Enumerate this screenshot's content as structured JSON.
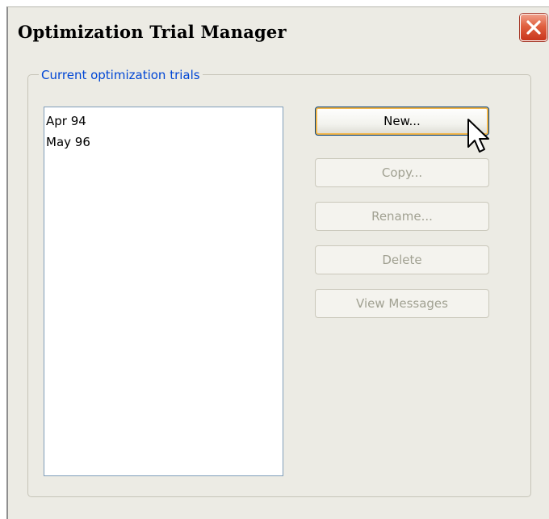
{
  "window": {
    "title": "Optimization Trial Manager"
  },
  "group": {
    "label": "Current optimization trials"
  },
  "trials": {
    "items": [
      "Apr 94",
      "May 96"
    ]
  },
  "buttons": {
    "new_label": "New...",
    "copy_label": "Copy...",
    "rename_label": "Rename...",
    "delete_label": "Delete",
    "view_messages_label": "View Messages",
    "copy_enabled": false,
    "rename_enabled": false,
    "delete_enabled": false,
    "view_messages_enabled": false
  },
  "icons": {
    "close": "close-icon",
    "cursor": "mouse-pointer-icon"
  },
  "colors": {
    "window_background": "#ecebe4",
    "group_label": "#0046d5",
    "close_button": "#e0603f",
    "disabled_text": "#a1a192",
    "focus_border": "#f3b74c"
  }
}
